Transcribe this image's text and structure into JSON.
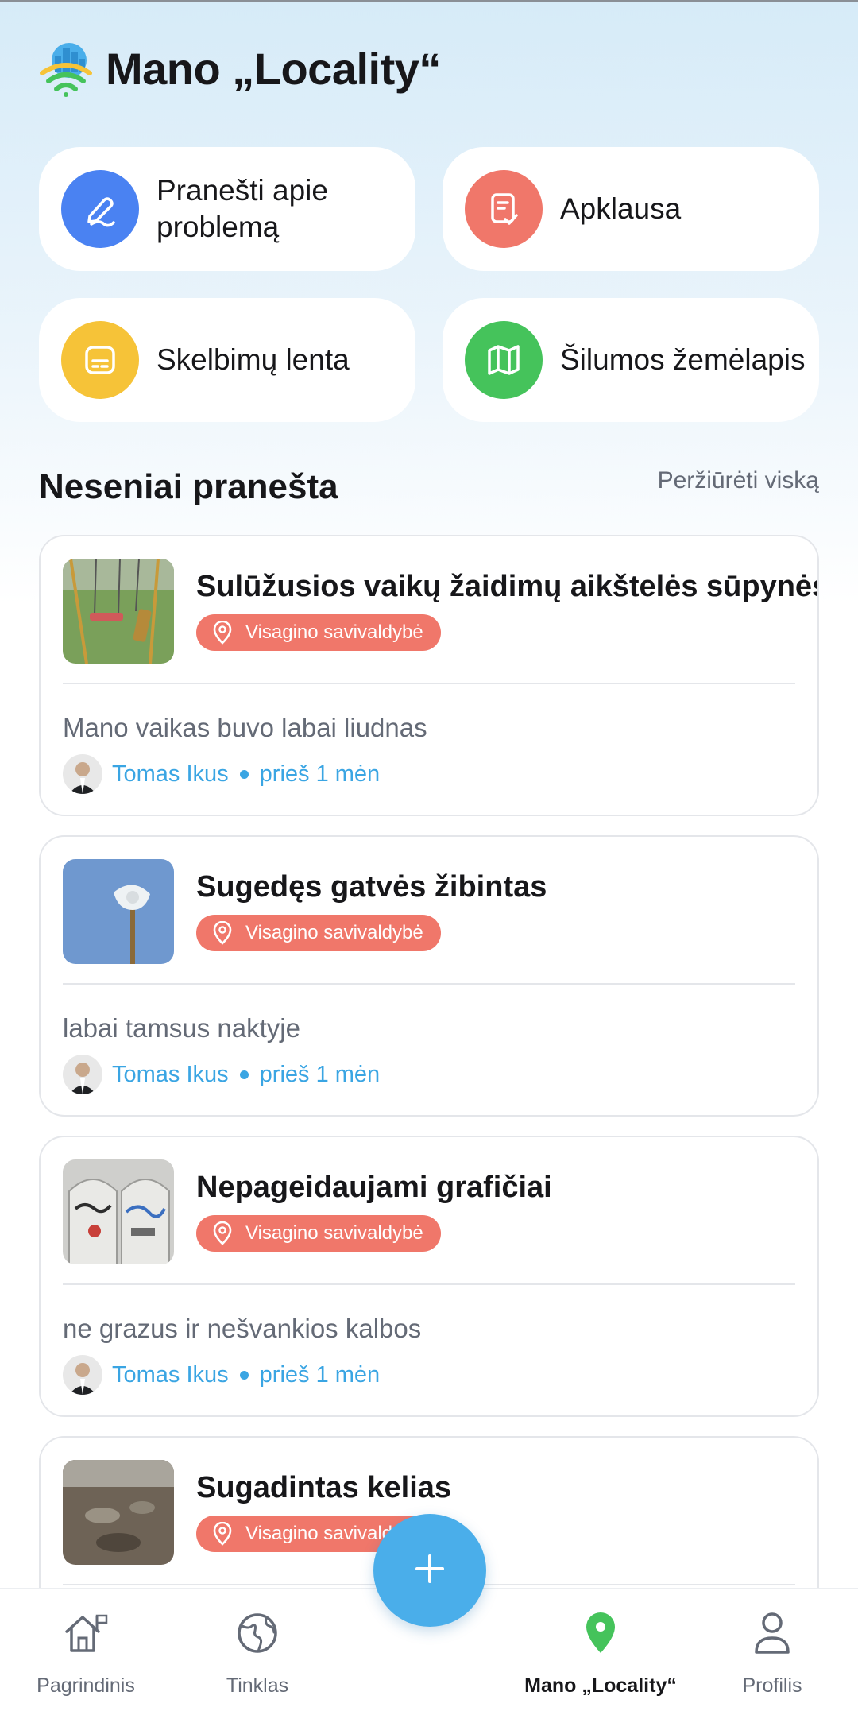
{
  "app": {
    "title": "Mano „Locality“"
  },
  "actions": [
    {
      "label": "Pranešti apie problemą",
      "icon": "pen-icon",
      "color": "#4a82f2"
    },
    {
      "label": "Apklausa",
      "icon": "survey-icon",
      "color": "#f0776a"
    },
    {
      "label": "Skelbimų lenta",
      "icon": "board-icon",
      "color": "#f6c338"
    },
    {
      "label": "Šilumos žemėlapis",
      "icon": "map-icon",
      "color": "#45c35b"
    }
  ],
  "recent": {
    "title": "Neseniai pranešta",
    "view_all": "Peržiūrėti viską",
    "reports": [
      {
        "title": "Sulūžusios vaikų žaidimų aikštelės sūpynės",
        "location": "Visagino savivaldybė",
        "description": "Mano vaikas buvo labai liudnas",
        "author": "Tomas Ikus",
        "time": "prieš 1 mėn"
      },
      {
        "title": "Sugedęs gatvės žibintas",
        "location": "Visagino savivaldybė",
        "description": "labai tamsus naktyje",
        "author": "Tomas Ikus",
        "time": "prieš 1 mėn"
      },
      {
        "title": "Nepageidaujami grafičiai",
        "location": "Visagino savivaldybė",
        "description": "ne grazus ir nešvankios kalbos",
        "author": "Tomas Ikus",
        "time": "prieš 1 mėn"
      },
      {
        "title": "Sugadintas kelias",
        "location": "Visagino savivaldybė",
        "description": "",
        "author": "",
        "time": ""
      }
    ]
  },
  "nav": {
    "items": [
      {
        "label": "Pagrindinis",
        "icon": "home-icon"
      },
      {
        "label": "Tinklas",
        "icon": "globe-icon"
      },
      {
        "label": "Mano „Locality“",
        "icon": "location-pin-icon",
        "active": true
      },
      {
        "label": "Profilis",
        "icon": "user-icon"
      }
    ],
    "fab_icon": "plus-icon"
  },
  "colors": {
    "accent": "#4aaeea",
    "badge": "#f0776a",
    "link": "#3aa5e3",
    "active_pin": "#45c35b"
  }
}
